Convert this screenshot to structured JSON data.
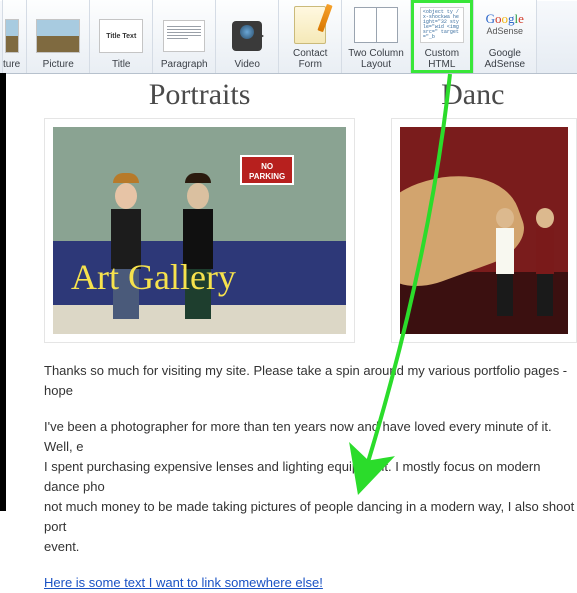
{
  "toolbar": {
    "items": [
      {
        "name": "picture-tool-cropped",
        "label": "ture"
      },
      {
        "name": "picture-tool",
        "label": "Picture"
      },
      {
        "name": "title-tool",
        "label": "Title",
        "preview": "Title Text"
      },
      {
        "name": "paragraph-tool",
        "label": "Paragraph"
      },
      {
        "name": "video-tool",
        "label": "Video"
      },
      {
        "name": "contact-form-tool",
        "label": "Contact\nForm"
      },
      {
        "name": "two-column-layout-tool",
        "label": "Two Column\nLayout"
      },
      {
        "name": "custom-html-tool",
        "label": "Custom\nHTML",
        "preview": "<object ty\n/x-shockwa\nheight=\"32\nstyle=\"wid\n<img src=\"\ntarget=\"_b"
      },
      {
        "name": "google-adsense-tool",
        "label": "Google\nAdSense"
      }
    ]
  },
  "page": {
    "columns": [
      {
        "title": "Portraits",
        "sign_line1": "NO",
        "sign_line2": "PARKING",
        "script": "Art Gallery"
      },
      {
        "title": "Danc"
      }
    ],
    "body_p1": "Thanks so much for visiting my site.  Please take a spin around my various portfolio pages - hope ",
    "body_p2": "I've been a photographer for more than ten years now and have loved every minute of it.  Well, e",
    "body_p3": "I spent purchasing expensive lenses and lighting equipment.  I mostly focus on modern dance pho",
    "body_p4": "not much money to be made taking pictures of people dancing in a modern way, I also shoot port",
    "body_p5": "event.",
    "link_text": "Here is some text I want to link somewhere else!"
  },
  "annotation": {
    "highlight": "custom-html-tool"
  }
}
